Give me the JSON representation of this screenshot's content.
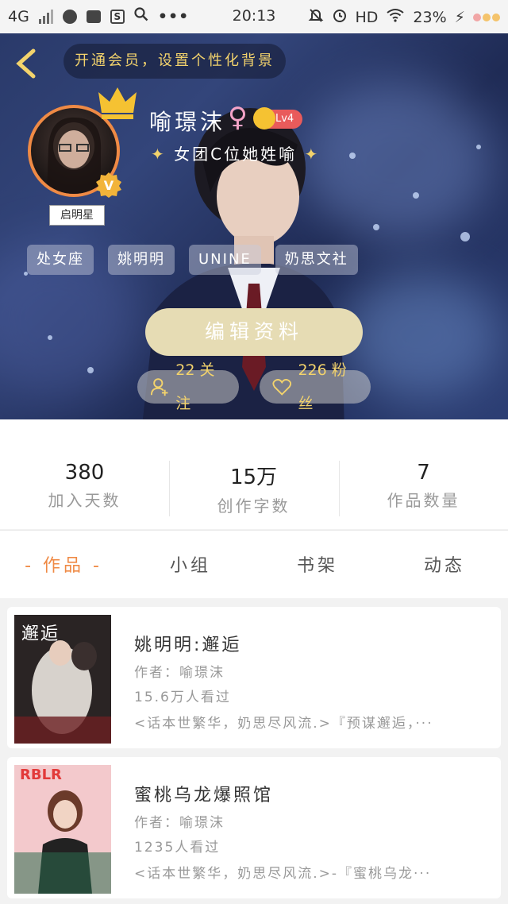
{
  "status_bar": {
    "network": "4G",
    "time": "20:13",
    "hd": "HD",
    "battery": "23%",
    "more": "•••"
  },
  "header": {
    "vip_banner": "开通会员，设置个性化背景"
  },
  "profile": {
    "name": "喻璟沫",
    "gender_symbol": "♀",
    "level": "Lv4",
    "motto": "女团C位她姓喻",
    "verified_tag": "启明星",
    "tags": [
      "处女座",
      "姚明明",
      "UNINE",
      "奶思文社"
    ],
    "edit_label": "编辑资料",
    "following_label": "22 关注",
    "followers_label": "226 粉丝"
  },
  "stats": [
    {
      "value": "380",
      "label": "加入天数"
    },
    {
      "value": "15万",
      "label": "创作字数"
    },
    {
      "value": "7",
      "label": "作品数量"
    }
  ],
  "tabs": [
    {
      "label": "- 作品 -",
      "active": true
    },
    {
      "label": "小组",
      "active": false
    },
    {
      "label": "书架",
      "active": false
    },
    {
      "label": "动态",
      "active": false
    }
  ],
  "works": [
    {
      "cover_title": "邂逅",
      "title": "姚明明:邂逅",
      "author": "作者：喻璟沫",
      "views": "15.6万人看过",
      "desc": "<话本世繁华，奶思尽风流.>『预谋邂逅，···"
    },
    {
      "cover_title": "RBLR",
      "title": "蜜桃乌龙爆照馆",
      "author": "作者：喻璟沫",
      "views": "1235人看过",
      "desc": "<话本世繁华，奶思尽风流.>-『蜜桃乌龙···"
    }
  ],
  "colors": {
    "accent": "#ef8a45",
    "gold": "#f3d36c",
    "edit_button": "#e6dcb4"
  }
}
